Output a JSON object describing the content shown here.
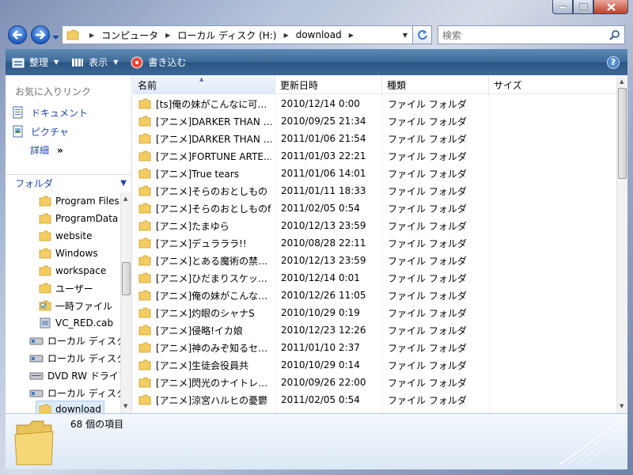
{
  "window": {
    "caption_buttons": [
      "minimize",
      "maximize",
      "close"
    ]
  },
  "address": {
    "segments": [
      "コンピュータ",
      "ローカル ディスク (H:)",
      "download"
    ]
  },
  "search": {
    "placeholder": "検索"
  },
  "toolbar": {
    "organize_label": "整理",
    "views_label": "表示",
    "burn_label": "書き込む",
    "help_label": "?"
  },
  "navpane": {
    "favorites_title": "お気に入りリンク",
    "favorites": [
      {
        "label": "ドキュメント",
        "icon": "documents-icon"
      },
      {
        "label": "ピクチャ",
        "icon": "pictures-icon"
      }
    ],
    "more_label": "詳細",
    "more_chevron": "»",
    "folders_label": "フォルダ",
    "tree": [
      {
        "label": "Program Files",
        "icon": "folder-icon"
      },
      {
        "label": "ProgramData",
        "icon": "folder-icon"
      },
      {
        "label": "website",
        "icon": "folder-icon"
      },
      {
        "label": "Windows",
        "icon": "folder-icon"
      },
      {
        "label": "workspace",
        "icon": "folder-icon"
      },
      {
        "label": "ユーザー",
        "icon": "folder-icon"
      },
      {
        "label": "一時ファイル",
        "icon": "folder-check-icon"
      },
      {
        "label": "VC_RED.cab",
        "icon": "cab-file-icon"
      },
      {
        "label": "ローカル ディスク",
        "icon": "drive-icon"
      },
      {
        "label": "ローカル ディスク",
        "icon": "drive-icon"
      },
      {
        "label": "DVD RW ドライブ",
        "icon": "dvd-drive-icon"
      },
      {
        "label": "ローカル ディスク",
        "icon": "drive-icon"
      },
      {
        "label": "download",
        "icon": "folder-icon"
      }
    ]
  },
  "columns": {
    "name": "名前",
    "date": "更新日時",
    "type": "種類",
    "size": "サイズ"
  },
  "files": [
    {
      "name": "[ts]俺の妹がこんなに可…",
      "date": "2010/12/14 0:00",
      "type": "ファイル フォルダ"
    },
    {
      "name": "[アニメ]DARKER THAN …",
      "date": "2010/09/25 21:34",
      "type": "ファイル フォルダ"
    },
    {
      "name": "[アニメ]DARKER THAN …",
      "date": "2011/01/06 21:54",
      "type": "ファイル フォルダ"
    },
    {
      "name": "[アニメ]FORTUNE ARTE…",
      "date": "2011/01/03 22:21",
      "type": "ファイル フォルダ"
    },
    {
      "name": "[アニメ]True tears",
      "date": "2011/01/06 14:01",
      "type": "ファイル フォルダ"
    },
    {
      "name": "[アニメ]そらのおとしもの",
      "date": "2011/01/11 18:33",
      "type": "ファイル フォルダ"
    },
    {
      "name": "[アニメ]そらのおとしものf",
      "date": "2011/02/05 0:54",
      "type": "ファイル フォルダ"
    },
    {
      "name": "[アニメ]たまゆら",
      "date": "2010/12/13 23:59",
      "type": "ファイル フォルダ"
    },
    {
      "name": "[アニメ]デュラララ!!",
      "date": "2010/08/28 22:11",
      "type": "ファイル フォルダ"
    },
    {
      "name": "[アニメ]とある魔術の禁…",
      "date": "2010/12/13 23:59",
      "type": "ファイル フォルダ"
    },
    {
      "name": "[アニメ]ひだまりスケッ…",
      "date": "2010/12/14 0:01",
      "type": "ファイル フォルダ"
    },
    {
      "name": "[アニメ]俺の妹がこんな…",
      "date": "2010/12/26 11:05",
      "type": "ファイル フォルダ"
    },
    {
      "name": "[アニメ]灼眼のシャナS",
      "date": "2010/10/29 0:19",
      "type": "ファイル フォルダ"
    },
    {
      "name": "[アニメ]侵略!イカ娘",
      "date": "2010/12/23 12:26",
      "type": "ファイル フォルダ"
    },
    {
      "name": "[アニメ]神のみぞ知るセ…",
      "date": "2011/01/10 2:37",
      "type": "ファイル フォルダ"
    },
    {
      "name": "[アニメ]生徒会役員共",
      "date": "2010/10/29 0:14",
      "type": "ファイル フォルダ"
    },
    {
      "name": "[アニメ]閃光のナイトレ…",
      "date": "2010/09/26 22:00",
      "type": "ファイル フォルダ"
    },
    {
      "name": "[アニメ]涼宮ハルヒの憂鬱",
      "date": "2011/02/05 0:54",
      "type": "ファイル フォルダ"
    }
  ],
  "status": {
    "item_count": "68 個の項目"
  }
}
